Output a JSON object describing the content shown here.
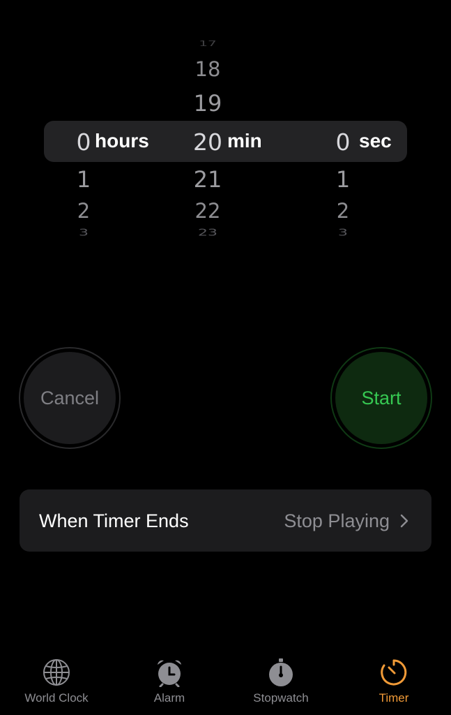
{
  "picker": {
    "hours": {
      "above": [
        "",
        ""
      ],
      "far_above": "",
      "selected": "0",
      "unit": "hours",
      "below": [
        "1",
        "2"
      ],
      "fade_below": "3"
    },
    "minutes": {
      "far_above": "17",
      "above": [
        "18",
        "19"
      ],
      "selected": "20",
      "unit": "min",
      "below": [
        "21",
        "22"
      ],
      "fade_below": "23"
    },
    "seconds": {
      "selected": "0",
      "unit": "sec",
      "below": [
        "1",
        "2"
      ],
      "fade_below": "3"
    }
  },
  "buttons": {
    "cancel_label": "Cancel",
    "start_label": "Start"
  },
  "timer_ends": {
    "title": "When Timer Ends",
    "value": "Stop Playing"
  },
  "tabs": [
    {
      "label": "World Clock",
      "icon": "globe-icon"
    },
    {
      "label": "Alarm",
      "icon": "alarm-clock-icon"
    },
    {
      "label": "Stopwatch",
      "icon": "stopwatch-icon"
    },
    {
      "label": "Timer",
      "icon": "timer-icon",
      "active": true
    }
  ],
  "colors": {
    "accent": "#f09a37",
    "start_green": "#36c852",
    "background": "#000000"
  }
}
